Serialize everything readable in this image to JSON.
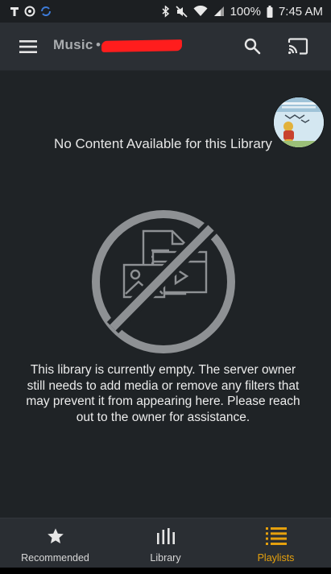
{
  "status_bar": {
    "battery": "100%",
    "time": "7:45 AM",
    "icons": [
      "tmobile-icon",
      "data-saver-icon",
      "sync-icon",
      "bluetooth-icon",
      "mute-icon",
      "wifi-icon",
      "signal-icon",
      "battery-icon"
    ]
  },
  "toolbar": {
    "title": "Music",
    "separator": "•",
    "icons": [
      "menu-icon",
      "search-icon",
      "cast-icon"
    ]
  },
  "content": {
    "empty_title": "No Content Available for this Library",
    "empty_description": "This library is currently empty. The server owner still needs to add media or remove any filters that may prevent it from appearing here. Please reach out to the owner for assistance."
  },
  "bottom_nav": {
    "items": [
      {
        "label": "Recommended",
        "icon": "star-icon",
        "active": false
      },
      {
        "label": "Library",
        "icon": "library-icon",
        "active": false
      },
      {
        "label": "Playlists",
        "icon": "playlist-icon",
        "active": true
      }
    ]
  },
  "colors": {
    "background": "#1f2326",
    "toolbar": "#2b2f34",
    "accent": "#e5a00d",
    "muted_graphic": "#8e9194"
  }
}
